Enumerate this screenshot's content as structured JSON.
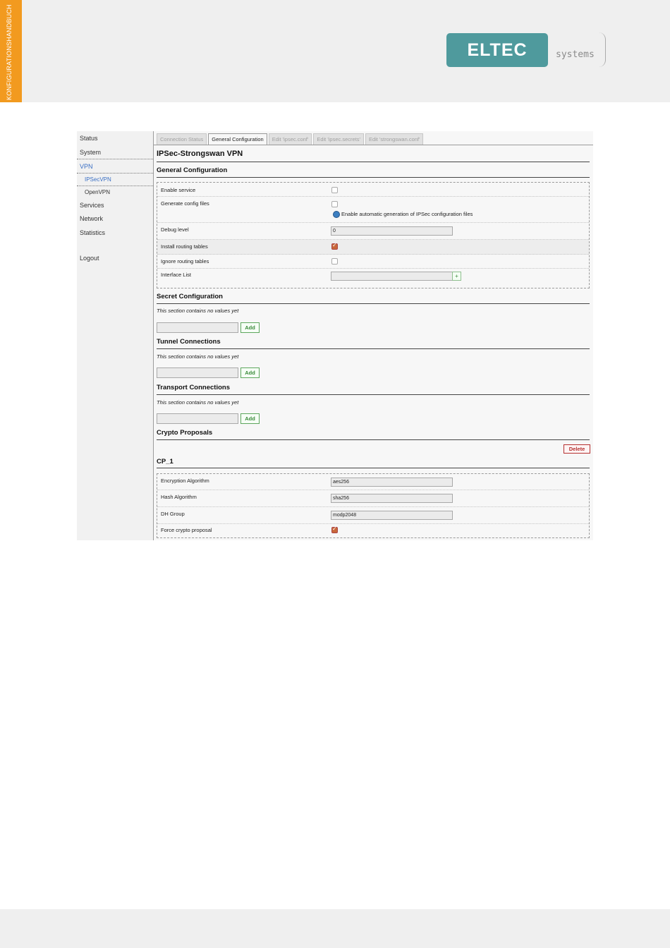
{
  "document": {
    "side_tab_text": "KONFIGURATIONSHANDBUCH",
    "logo_main": "ELTEC",
    "logo_sub": "systems"
  },
  "nav": {
    "items": [
      {
        "label": "Status"
      },
      {
        "label": "System"
      },
      {
        "label": "VPN"
      },
      {
        "label": "IPSecVPN"
      },
      {
        "label": "OpenVPN"
      },
      {
        "label": "Services"
      },
      {
        "label": "Network"
      },
      {
        "label": "Statistics"
      },
      {
        "label": "Logout"
      }
    ]
  },
  "tabs": [
    {
      "label": "Connection Status"
    },
    {
      "label": "General Configuration",
      "active": true
    },
    {
      "label": "Edit 'ipsec.conf'"
    },
    {
      "label": "Edit 'ipsec.secrets'"
    },
    {
      "label": "Edit 'strongswan.conf'"
    }
  ],
  "page_title": "IPSec-Strongswan VPN",
  "general": {
    "title": "General Configuration",
    "enable_service": {
      "label": "Enable service",
      "checked": false
    },
    "generate_config": {
      "label": "Generate config files",
      "checked": false,
      "hint": "Enable automatic generation of IPSec configuration files"
    },
    "debug_level": {
      "label": "Debug level",
      "value": "0"
    },
    "install_routing": {
      "label": "Install routing tables",
      "checked": true
    },
    "ignore_routing": {
      "label": "Ignore routing tables",
      "checked": false
    },
    "interface_list": {
      "label": "Interface List",
      "value": "",
      "add_symbol": "+"
    }
  },
  "secret": {
    "title": "Secret Configuration",
    "note": "This section contains no values yet",
    "add_label": "Add"
  },
  "tunnel": {
    "title": "Tunnel Connections",
    "note": "This section contains no values yet",
    "add_label": "Add"
  },
  "transport": {
    "title": "Transport Connections",
    "note": "This section contains no values yet",
    "add_label": "Add"
  },
  "crypto": {
    "title": "Crypto Proposals",
    "delete_label": "Delete",
    "proposal_name": "CP_1",
    "encryption": {
      "label": "Encryption Algorithm",
      "value": "aes256"
    },
    "hash": {
      "label": "Hash Algorithm",
      "value": "sha256"
    },
    "dh_group": {
      "label": "DH Group",
      "value": "modp2048"
    },
    "force": {
      "label": "Force crypto proposal",
      "checked": true
    }
  },
  "colors": {
    "accent_tab": "#f29a1f",
    "logo": "#4f9a9d",
    "nav_active": "#3a6fc4",
    "add_button": "#3b8a3b",
    "delete_button": "#b53030",
    "checkbox_checked": "#c8673a"
  }
}
